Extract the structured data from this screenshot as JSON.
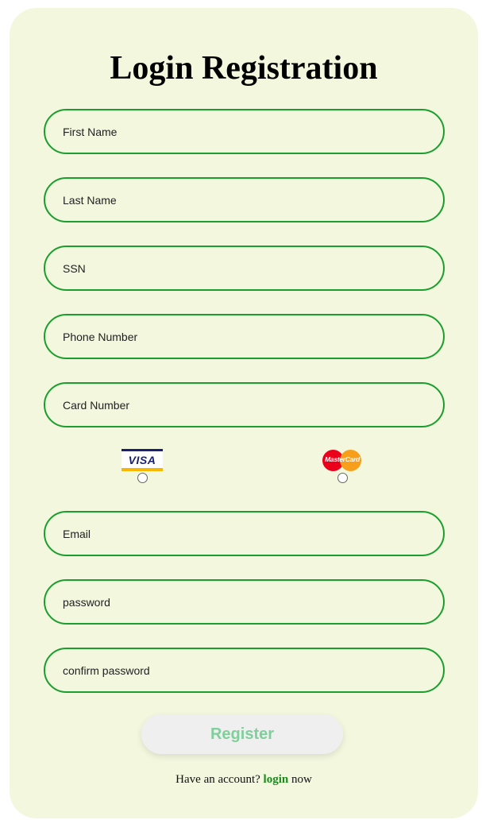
{
  "form": {
    "title": "Login Registration",
    "fields": {
      "first_name": {
        "value": "",
        "placeholder": "First Name"
      },
      "last_name": {
        "value": "",
        "placeholder": "Last Name"
      },
      "ssn": {
        "value": "",
        "placeholder": "SSN"
      },
      "phone_number": {
        "value": "",
        "placeholder": "Phone Number"
      },
      "card_number": {
        "value": "",
        "placeholder": "Card Number"
      },
      "email": {
        "value": "",
        "placeholder": "Email"
      },
      "password": {
        "value": "",
        "placeholder": "password"
      },
      "confirm_password": {
        "value": "",
        "placeholder": "confirm password"
      }
    },
    "card_types": {
      "visa": {
        "logo_text": "VISA",
        "selected": false
      },
      "mastercard": {
        "logo_text": "MasterCard",
        "selected": false
      }
    },
    "register_label": "Register",
    "footer": {
      "prefix": "Have an account? ",
      "link_label": "login",
      "suffix": " now"
    }
  },
  "colors": {
    "card_background": "#f2f7de",
    "field_border": "#1c9e2e",
    "register_text": "#7fcf9b",
    "login_link": "#1d8a1d"
  }
}
